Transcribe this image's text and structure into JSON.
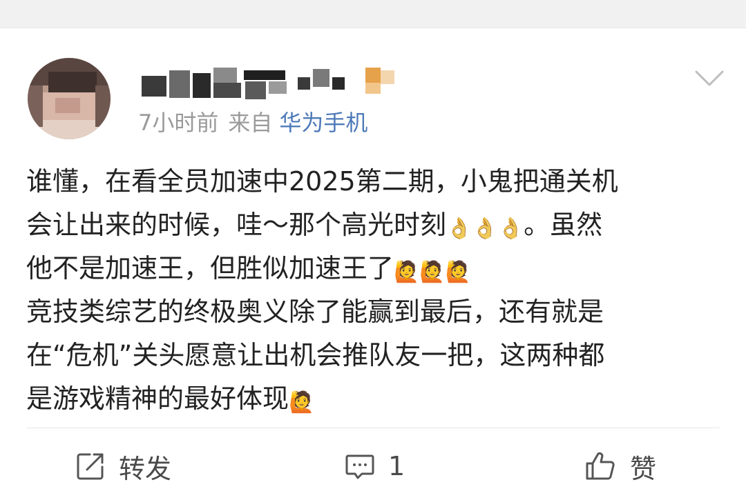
{
  "header": {
    "time_text": "7小时前",
    "from_label": "来自",
    "device": "华为手机"
  },
  "post": {
    "line1": "谁懂，在看全员加速中2025第二期，小鬼把通关机",
    "line2": "会让出来的时候，哇～那个高光时刻",
    "line2_tail": "。虽然",
    "line3": "他不是加速王，但胜似加速王了",
    "line4": "竞技类综艺的终极奥义除了能赢到最后，还有就是",
    "line5": "在“危机”关头愿意让出机会推队友一把，这两种都",
    "line6": "是游戏精神的最好体现",
    "emoji_ok": "👌",
    "emoji_wave": "🙋"
  },
  "actions": {
    "repost_label": "转发",
    "comment_count": "1",
    "like_label": "赞"
  },
  "icons": {
    "more": "chevron-down-icon",
    "repost": "share-edit-icon",
    "comment": "comment-bubble-icon",
    "like": "thumbs-up-icon"
  },
  "colors": {
    "link_blue": "#4d7ab8",
    "meta_gray": "#9a9a9a",
    "text": "#222222"
  }
}
